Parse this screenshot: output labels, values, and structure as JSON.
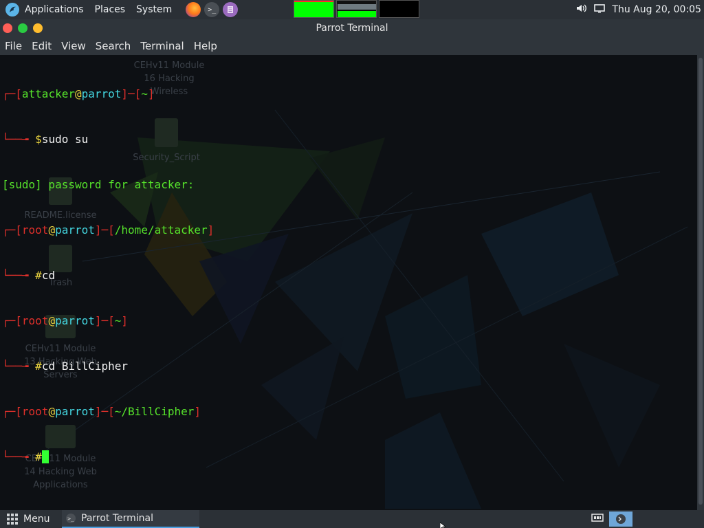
{
  "top_panel": {
    "applications": "Applications",
    "places": "Places",
    "system": "System",
    "clock": "Thu Aug 20, 00:05",
    "icons": [
      "parrot-logo-icon",
      "firefox-icon",
      "terminal-icon",
      "text-editor-icon",
      "volume-icon",
      "display-icon"
    ]
  },
  "window": {
    "title": "Parrot Terminal",
    "menu": [
      "File",
      "Edit",
      "View",
      "Search",
      "Terminal",
      "Help"
    ]
  },
  "terminal": {
    "lines": [
      {
        "user": "attacker",
        "host": "parrot",
        "path": "~"
      },
      {
        "sym": "$",
        "cmd": "sudo su"
      },
      {
        "text": "[sudo] password for attacker:"
      },
      {
        "user": "root",
        "host": "parrot",
        "path": "/home/attacker"
      },
      {
        "sym": "#",
        "cmd": "cd"
      },
      {
        "user": "root",
        "host": "parrot",
        "path": "~"
      },
      {
        "sym": "#",
        "cmd": "cd BillCipher"
      },
      {
        "user": "root",
        "host": "parrot",
        "path": "~/BillCipher"
      },
      {
        "sym": "#",
        "cmd": ""
      }
    ]
  },
  "desktop_icons": [
    {
      "label": "CEHv11 Module 16 Hacking Wireless"
    },
    {
      "label": "Security_Script"
    },
    {
      "label": "README.license"
    },
    {
      "label": "Trash"
    },
    {
      "label": "CEHv11 Module 13 Hacking Web Servers"
    },
    {
      "label": "CEHv11 Module 14 Hacking Web Applications"
    }
  ],
  "bottom_panel": {
    "menu": "Menu",
    "task": "Parrot Terminal"
  },
  "colors": {
    "panel": "#2b3036",
    "terminal_bg": "#0d1014",
    "prompt_red": "#e0302b",
    "prompt_green": "#56e32b",
    "prompt_yellow": "#e8d23f",
    "prompt_cyan": "#44d6e0",
    "cursor": "#33ff33"
  }
}
